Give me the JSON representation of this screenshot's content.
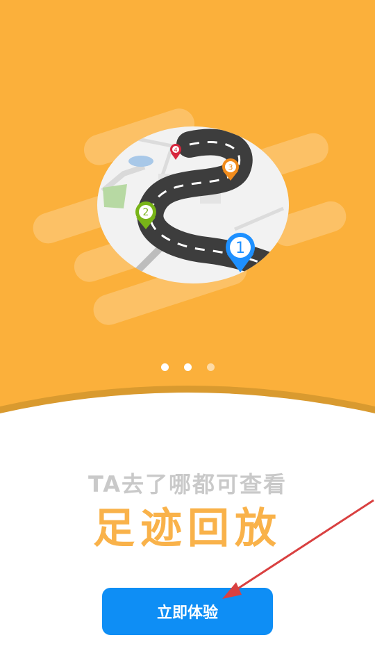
{
  "onboarding": {
    "subtitle": "TA去了哪都可查看",
    "title": "足迹回放",
    "cta_label": "立即体验",
    "page_indicator": {
      "total": 3,
      "active_index": 0
    },
    "markers": [
      "1",
      "2",
      "3",
      "4"
    ]
  },
  "colors": {
    "background": "#FBB03B",
    "title": "#F9B24A",
    "subtitle": "#C9C9C9",
    "button": "#0E8EF5",
    "annotation_arrow": "#D94040"
  }
}
